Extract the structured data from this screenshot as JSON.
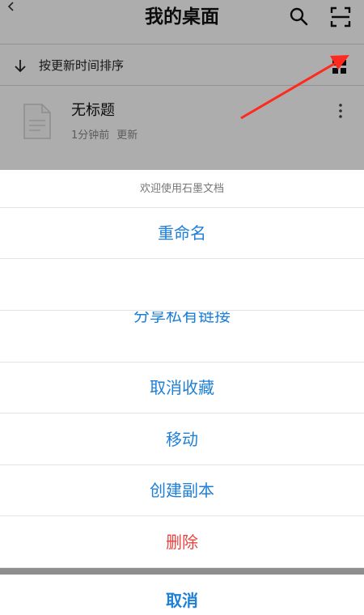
{
  "app": {
    "title": "我的桌面",
    "sort_label": "按更新时间排序",
    "file": {
      "name": "无标题",
      "time": "1分钟前",
      "action": "更新"
    }
  },
  "sheet": {
    "header": "欢迎使用石墨文档",
    "options": {
      "rename": "重命名",
      "share_link": "分享私有链接",
      "unfavorite": "取消收藏",
      "move": "移动",
      "copy": "创建副本",
      "delete": "删除"
    },
    "cancel": "取消"
  },
  "colors": {
    "accent": "#1e7fd6",
    "danger": "#e64340",
    "annotation_arrow": "#ff2a1f"
  },
  "icons": [
    "back-icon",
    "search-icon",
    "scan-icon",
    "sort-arrow-icon",
    "grid-view-icon",
    "document-icon",
    "more-icon"
  ]
}
